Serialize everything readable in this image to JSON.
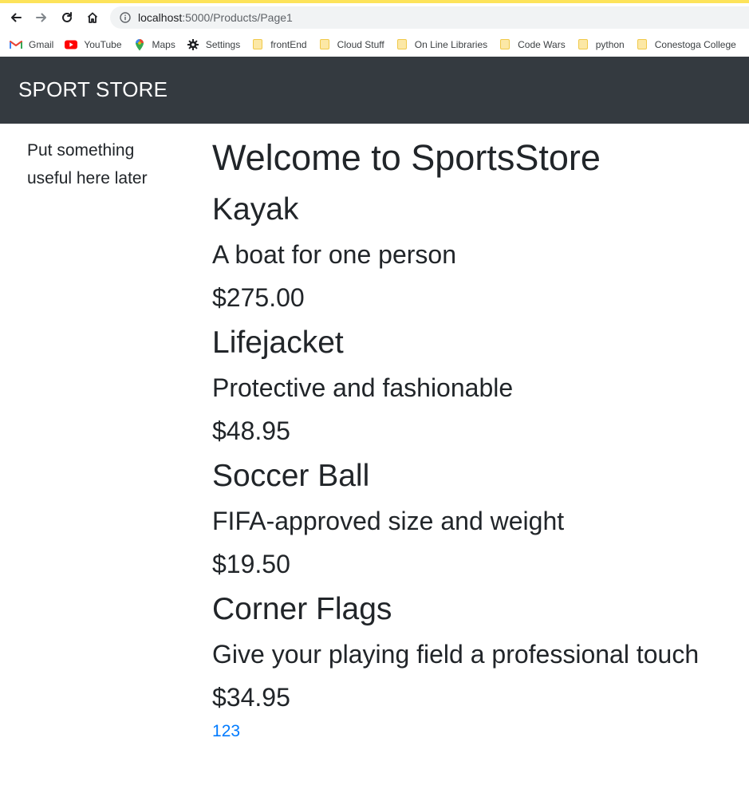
{
  "browser": {
    "url_host": "localhost",
    "url_path": ":5000/Products/Page1",
    "accent_color": "#fde35a"
  },
  "bookmarks": [
    {
      "label": "Gmail",
      "icon": "gmail-icon"
    },
    {
      "label": "YouTube",
      "icon": "youtube-icon"
    },
    {
      "label": "Maps",
      "icon": "maps-icon"
    },
    {
      "label": "Settings",
      "icon": "gear-icon"
    },
    {
      "label": "frontEnd",
      "icon": "folder-icon"
    },
    {
      "label": "Cloud Stuff",
      "icon": "folder-icon"
    },
    {
      "label": "On Line Libraries",
      "icon": "folder-icon"
    },
    {
      "label": "Code Wars",
      "icon": "folder-icon"
    },
    {
      "label": "python",
      "icon": "folder-icon"
    },
    {
      "label": "Conestoga College",
      "icon": "folder-icon"
    }
  ],
  "navbar": {
    "brand": "SPORT STORE",
    "background": "#343a40"
  },
  "sidebar": {
    "text": "Put something useful here later"
  },
  "main": {
    "heading": "Welcome to SportsStore",
    "products": [
      {
        "name": "Kayak",
        "description": "A boat for one person",
        "price": "$275.00"
      },
      {
        "name": "Lifejacket",
        "description": "Protective and fashionable",
        "price": "$48.95"
      },
      {
        "name": "Soccer Ball",
        "description": "FIFA-approved size and weight",
        "price": "$19.50"
      },
      {
        "name": "Corner Flags",
        "description": "Give your playing field a professional touch",
        "price": "$34.95"
      }
    ],
    "pagination": [
      "1",
      "2",
      "3"
    ],
    "link_color": "#007bff"
  }
}
